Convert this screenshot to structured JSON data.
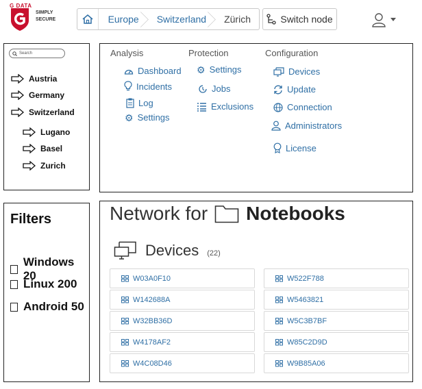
{
  "header": {
    "logo_top": "G DATA",
    "logo_line1": "SIMPLY",
    "logo_line2": "SECURE",
    "breadcrumb": [
      "Europe",
      "Switzerland",
      "Zürich"
    ],
    "switch_node_label": "Switch node"
  },
  "tree": {
    "search_placeholder": "Search",
    "items": [
      "Austria",
      "Germany",
      "Switzerland"
    ],
    "children": [
      "Lugano",
      "Basel",
      "Zurich"
    ]
  },
  "menu": {
    "analysis": {
      "title": "Analysis",
      "links": [
        "Dashboard",
        "Incidents",
        "Log",
        "Settings"
      ]
    },
    "protection": {
      "title": "Protection",
      "links": [
        "Settings",
        "Jobs",
        "Exclusions"
      ]
    },
    "configuration": {
      "title": "Configuration",
      "links": [
        "Devices",
        "Update",
        "Connection",
        "Administrators",
        "License"
      ]
    }
  },
  "filters": {
    "title": "Filters",
    "items": [
      "Windows 20",
      "Linux 200",
      "Android 50"
    ]
  },
  "network": {
    "title_prefix": "Network for",
    "group_name": "Notebooks",
    "devices_label": "Devices",
    "devices_count": "(22)",
    "devices_left": [
      "W03A0F10",
      "W142688A",
      "W32BB36D",
      "W4178AF2",
      "W4C08D46"
    ],
    "devices_right": [
      "W522F788",
      "W5463821",
      "W5C3B7BF",
      "W85C2D9D",
      "W9B85A06"
    ]
  },
  "colors": {
    "accent_link": "#2f6fa5",
    "brand_red": "#c8102e",
    "panel_border": "#222222"
  }
}
